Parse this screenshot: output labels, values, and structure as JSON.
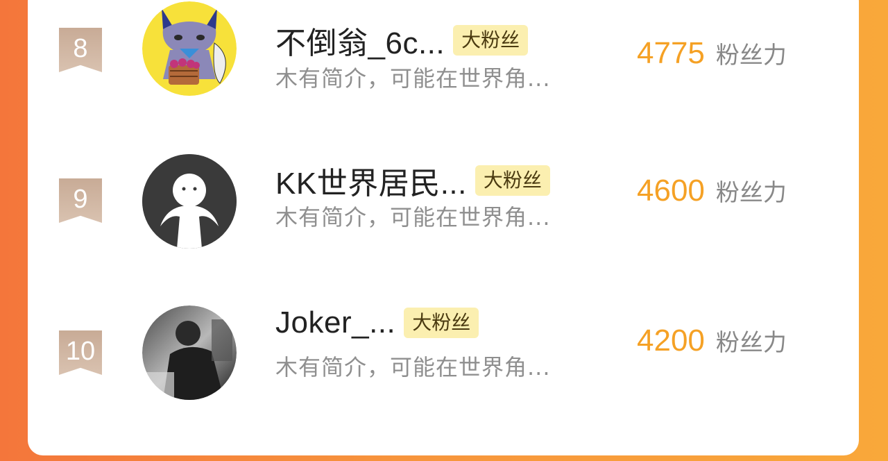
{
  "ranking": {
    "entries": [
      {
        "rank": "8",
        "name": "不倒翁_6c...",
        "badge": "大粉丝",
        "bio": "木有简介，可能在世界角...",
        "score": "4775",
        "score_unit": "粉丝力",
        "avatar_icon": "cartoon-cat-avatar"
      },
      {
        "rank": "9",
        "name": "KK世界居民...",
        "badge": "大粉丝",
        "bio": "木有简介，可能在世界角...",
        "score": "4600",
        "score_unit": "粉丝力",
        "avatar_icon": "default-user-avatar"
      },
      {
        "rank": "10",
        "name": "Joker_...",
        "badge": "大粉丝",
        "bio": "木有简介，可能在世界角...",
        "score": "4200",
        "score_unit": "粉丝力",
        "avatar_icon": "photo-avatar"
      }
    ]
  },
  "colors": {
    "background_start": "#f4763b",
    "background_end": "#f9a83a",
    "score": "#f5a125",
    "badge_bg": "#fbefb0",
    "rank_ribbon": "#c8ab96"
  }
}
